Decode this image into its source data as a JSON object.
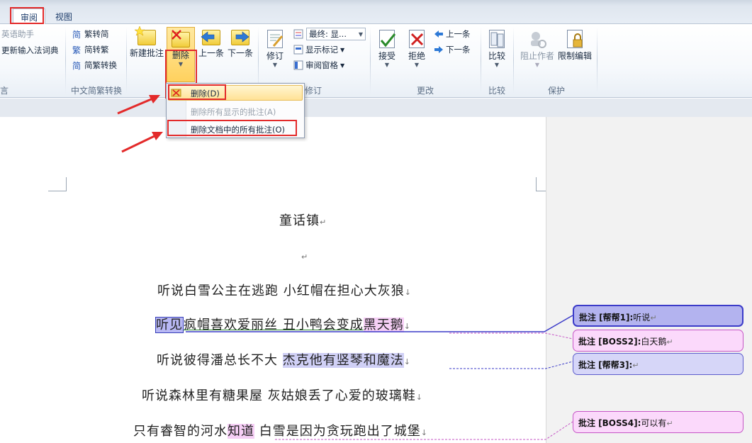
{
  "tabs": [
    {
      "label": "审阅",
      "active": true
    },
    {
      "label": "视图",
      "active": false
    }
  ],
  "ribbon": {
    "proofing_partial": {
      "items": [
        "英语助手",
        "更新输入法词典"
      ],
      "label": "语言"
    },
    "chinese_conversion": {
      "items": [
        "繁转简",
        "简转繁",
        "简繁转换"
      ],
      "label": "中文简繁转换"
    },
    "comments": {
      "new_comment": "新建批注",
      "delete": "删除",
      "previous": "上一条",
      "next": "下一条"
    },
    "tracking": {
      "track_changes": "修订",
      "display_combo": "最终: 显...",
      "show_markup": "显示标记",
      "reviewing_pane": "审阅窗格",
      "label": "修订"
    },
    "changes": {
      "accept": "接受",
      "reject": "拒绝",
      "previous": "上一条",
      "next": "下一条",
      "label": "更改"
    },
    "compare": {
      "compare": "比较",
      "label": "比较"
    },
    "protect": {
      "block_authors": "阻止作者",
      "restrict_editing": "限制编辑",
      "label": "保护"
    }
  },
  "delete_menu": {
    "items": [
      {
        "label": "删除(D)",
        "enabled": true
      },
      {
        "label": "删除所有显示的批注(A)",
        "enabled": false
      },
      {
        "label": "删除文档中的所有批注(O)",
        "enabled": true
      }
    ]
  },
  "document": {
    "title": "童话镇",
    "lines": [
      {
        "plain_a": "听说白雪公主在逃跑  小红帽在担心大灰狼"
      },
      {
        "hl_a": "听见",
        "plain_a": "疯帽喜欢爱丽丝  丑小鸭会变成",
        "hl_b": "黑天鹅"
      },
      {
        "plain_a": "听说彼得潘总长不大  ",
        "hl_a": "杰克他有竖琴和魔法"
      },
      {
        "plain_a": "听说森林里有糖果屋  灰姑娘丢了心爱的玻璃鞋"
      },
      {
        "plain_a": "只有睿智的河水",
        "hl_a": "知道",
        "plain_b": " 白雪是因为贪玩跑出了城堡"
      }
    ]
  },
  "comments": [
    {
      "prefix": "批注 [帮帮1]:",
      "text": "听说",
      "color": "#b3b3ef"
    },
    {
      "prefix": "批注 [BOSS2]:",
      "text": "白天鹅",
      "color": "#fbd9fb"
    },
    {
      "prefix": "批注 [帮帮3]:",
      "text": "",
      "color": "#d6d6f8"
    },
    {
      "prefix": "批注 [BOSS4]:",
      "text": "可以有",
      "color": "#fbd9fb"
    }
  ],
  "icons": [
    "new-comment-icon",
    "delete-comment-icon",
    "previous-comment-icon",
    "next-comment-icon",
    "track-changes-icon",
    "accept-icon",
    "reject-icon",
    "compare-icon",
    "block-authors-icon",
    "restrict-editing-icon"
  ],
  "colors": {
    "annotation_red": "#e32a2a",
    "comment_blue": "#3b3bc9",
    "comment_pink": "#c655c6"
  }
}
